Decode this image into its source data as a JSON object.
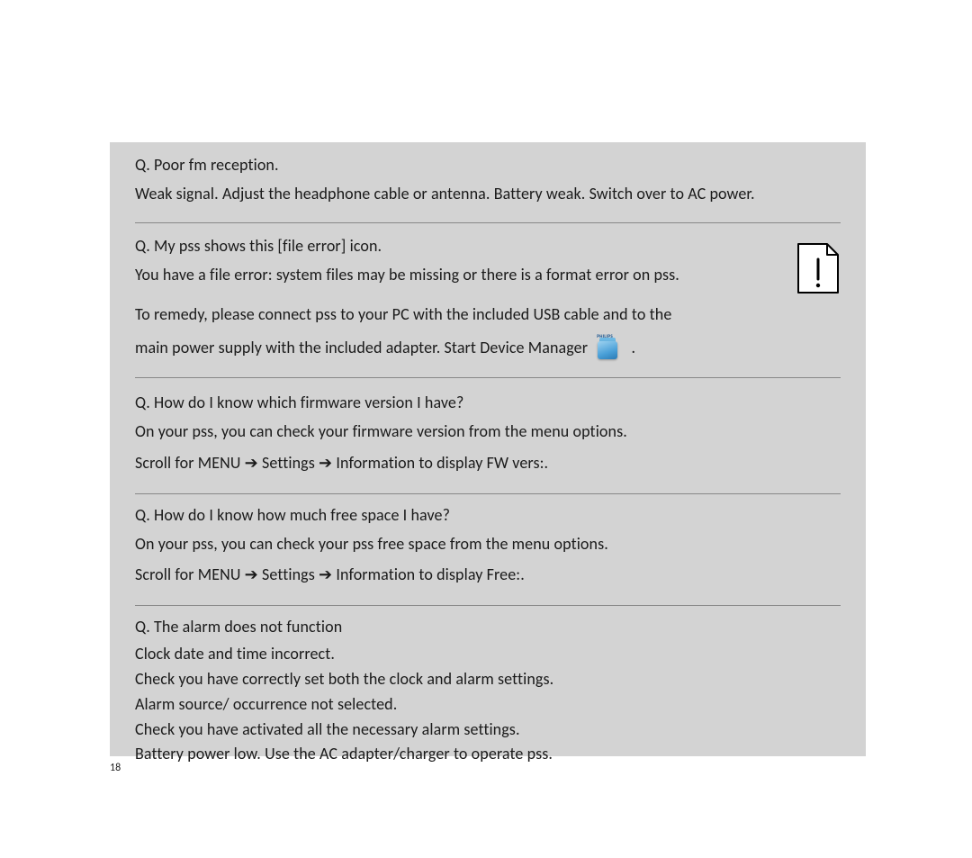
{
  "page_number": "18",
  "arrow": "➔",
  "q1": {
    "question": "Q. Poor fm reception.",
    "answer": "Weak signal.  Adjust the headphone cable or antenna. Battery weak. Switch over to AC power."
  },
  "q2": {
    "question": "Q. My pss shows this [file error] icon.",
    "answer_p1": "You have a file error: system files may be missing or there is a format error on pss.",
    "answer_p2a": "To remedy, please connect pss to your PC with the included USB cable and to the",
    "answer_p2b_prefix": "main power supply with the included adapter.  Start Device Manager  ",
    "answer_p2b_suffix": " .",
    "icon_brand": "PHILIPS"
  },
  "q3": {
    "question": "Q. How do I know which firmware version I have?",
    "answer_p1": "On your pss, you can check your firmware version from the menu options.",
    "scroll_prefix": "Scroll for ",
    "menu": "MENU",
    "settings": "Settings",
    "information": "Information",
    "display_prefix": " to display ",
    "fw_vers": "FW vers:",
    "period": "."
  },
  "q4": {
    "question": "Q. How do I know how much free space I have?",
    "answer_p1": "On your pss, you can check your pss free space from the menu options.",
    "scroll_prefix": "Scroll for ",
    "menu": "MENU",
    "settings": "Settings",
    "information": "Information",
    "display_prefix": " to display ",
    "free": "Free:",
    "period": "."
  },
  "q5": {
    "question": "Q. The alarm does not function",
    "lines": {
      "l1": "Clock date and time incorrect.",
      "l2": "Check you have correctly set both the clock and alarm settings.",
      "l3": "Alarm source/ occurrence not selected.",
      "l4": "Check you have activated all the necessary alarm settings.",
      "l5": "Battery power low. Use the AC adapter/charger to operate pss."
    }
  }
}
